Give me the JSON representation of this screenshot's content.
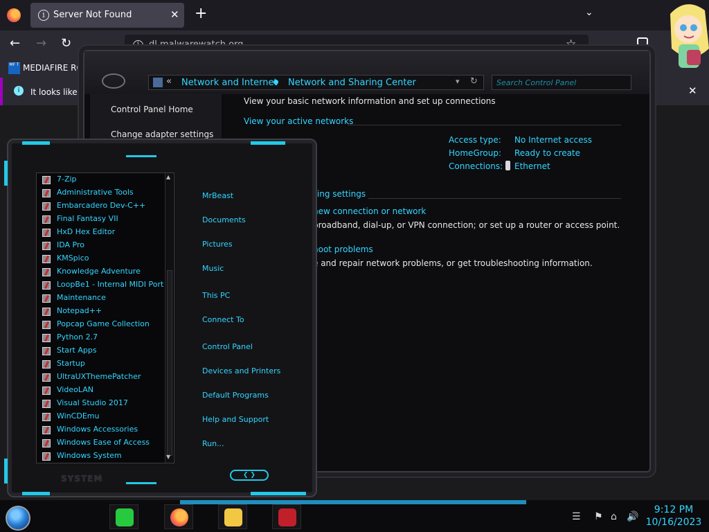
{
  "browser": {
    "tab_title": "Server Not Found",
    "url": "dl.malwarewatch.org",
    "bookmark_label": "MEDIAFIRE RO",
    "bookmark_icon_text": "MF T",
    "notice_text": "It looks like y"
  },
  "control_panel": {
    "breadcrumb_root_chevron": "«",
    "breadcrumb_1": "Network and Internet",
    "breadcrumb_2": "Network and Sharing Center",
    "search_placeholder": "Search Control Panel",
    "sidebar": [
      {
        "label": "Control Panel Home"
      },
      {
        "label": "Change adapter settings"
      }
    ],
    "heading": "View your basic network information and set up connections",
    "active_networks_link": "View your active networks",
    "access_type_key": "Access type:",
    "access_type_value": "No Internet access",
    "homegroup_key": "HomeGroup:",
    "homegroup_value": "Ready to create",
    "connections_key": "Connections:",
    "connections_value": "Ethernet",
    "change_settings_heading": "rking settings",
    "new_connection_link": "new connection or network",
    "new_connection_desc": "broadband, dial-up, or VPN connection; or set up a router or access point.",
    "troubleshoot_link": "hoot problems",
    "troubleshoot_desc": "e and repair network problems, or get troubleshooting information."
  },
  "start_menu": {
    "programs": [
      "7-Zip",
      "Administrative Tools",
      "Embarcadero Dev-C++",
      "Final Fantasy VII",
      "HxD Hex Editor",
      "IDA Pro",
      "KMSpico",
      "Knowledge Adventure",
      "LoopBe1 - Internal MIDI Port",
      "Maintenance",
      "Notepad++",
      "Popcap Game Collection",
      "Python 2.7",
      "Start Apps",
      "Startup",
      "UltraUXThemePatcher",
      "VideoLAN",
      "Visual Studio 2017",
      "WinCDEmu",
      "Windows Accessories",
      "Windows Ease of Access",
      "Windows System"
    ],
    "right_items": [
      "MrBeast",
      "Documents",
      "Pictures",
      "Music",
      "This PC",
      "Connect To",
      "Control Panel",
      "Devices and Printers",
      "Default Programs",
      "Help and Support",
      "Run..."
    ],
    "footer_label": "SYSTEM"
  },
  "taskbar": {
    "time": "9:12 PM",
    "date": "10/16/2023",
    "apps": [
      {
        "icon": "notes-icon",
        "color": "#27c93f"
      },
      {
        "icon": "firefox-icon",
        "color": "#ff7139"
      },
      {
        "icon": "file-explorer-icon",
        "color": "#f2c744"
      },
      {
        "icon": "game-icon",
        "color": "#c0202a"
      }
    ]
  },
  "colors": {
    "accent_cyan": "#33d6ff",
    "frame_cyan": "#22c9e8",
    "window_bg": "#0d0d10"
  }
}
